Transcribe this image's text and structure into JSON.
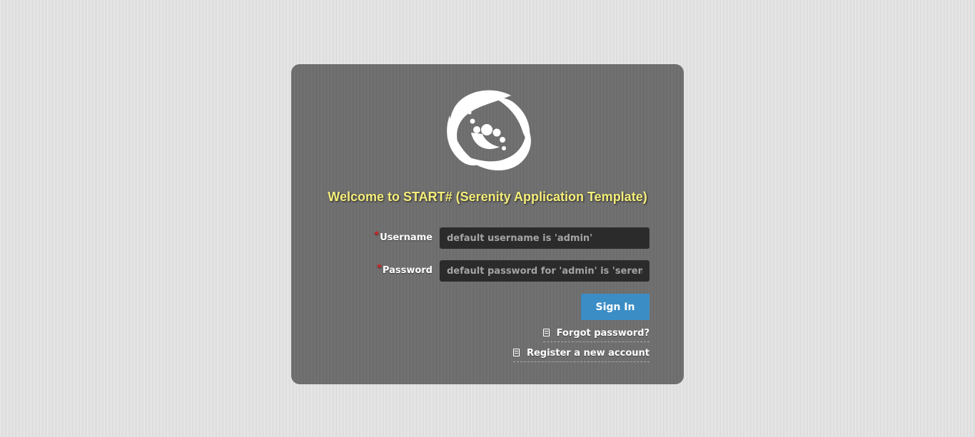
{
  "login": {
    "title": "Welcome to START# (Serenity Application Template)",
    "username": {
      "label": "Username",
      "required_marker": "*",
      "placeholder": "default username is 'admin'",
      "value": ""
    },
    "password": {
      "label": "Password",
      "required_marker": "*",
      "placeholder": "default password for 'admin' is 'serenity'",
      "value": ""
    },
    "sign_in_label": "Sign In",
    "forgot_password": {
      "icon": "document-icon",
      "label": "Forgot password?"
    },
    "register": {
      "icon": "document-icon",
      "label": "Register a new account"
    }
  },
  "logo": {
    "icon": "serenity-swirl-logo"
  },
  "colors": {
    "title": "#f5ee7a",
    "button": "#3b8dc5",
    "required": "#d62020",
    "input_background": "#2b2b2b",
    "panel": "#707070"
  }
}
